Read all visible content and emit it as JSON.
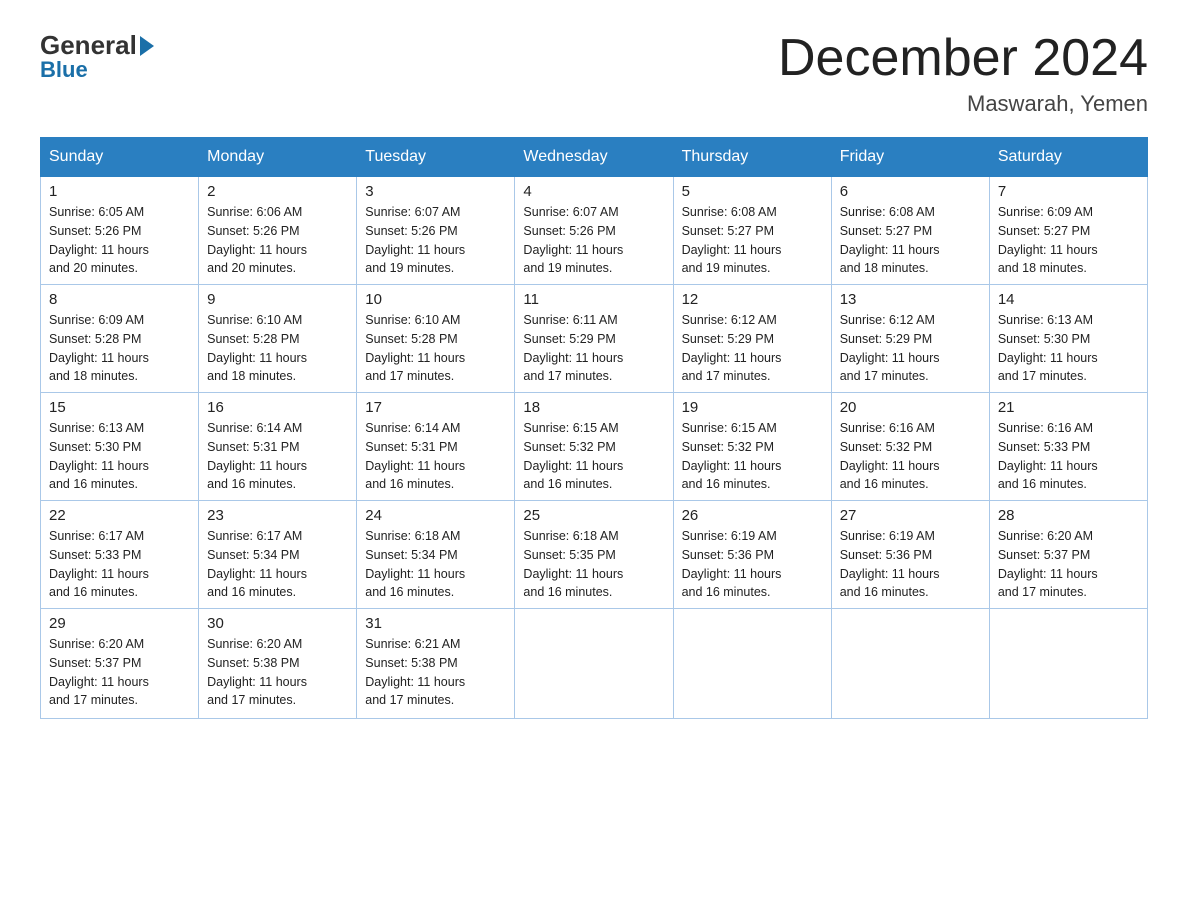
{
  "logo": {
    "general": "General",
    "blue": "Blue"
  },
  "title": {
    "month_year": "December 2024",
    "location": "Maswarah, Yemen"
  },
  "headers": [
    "Sunday",
    "Monday",
    "Tuesday",
    "Wednesday",
    "Thursday",
    "Friday",
    "Saturday"
  ],
  "weeks": [
    [
      {
        "day": "1",
        "info": "Sunrise: 6:05 AM\nSunset: 5:26 PM\nDaylight: 11 hours\nand 20 minutes."
      },
      {
        "day": "2",
        "info": "Sunrise: 6:06 AM\nSunset: 5:26 PM\nDaylight: 11 hours\nand 20 minutes."
      },
      {
        "day": "3",
        "info": "Sunrise: 6:07 AM\nSunset: 5:26 PM\nDaylight: 11 hours\nand 19 minutes."
      },
      {
        "day": "4",
        "info": "Sunrise: 6:07 AM\nSunset: 5:26 PM\nDaylight: 11 hours\nand 19 minutes."
      },
      {
        "day": "5",
        "info": "Sunrise: 6:08 AM\nSunset: 5:27 PM\nDaylight: 11 hours\nand 19 minutes."
      },
      {
        "day": "6",
        "info": "Sunrise: 6:08 AM\nSunset: 5:27 PM\nDaylight: 11 hours\nand 18 minutes."
      },
      {
        "day": "7",
        "info": "Sunrise: 6:09 AM\nSunset: 5:27 PM\nDaylight: 11 hours\nand 18 minutes."
      }
    ],
    [
      {
        "day": "8",
        "info": "Sunrise: 6:09 AM\nSunset: 5:28 PM\nDaylight: 11 hours\nand 18 minutes."
      },
      {
        "day": "9",
        "info": "Sunrise: 6:10 AM\nSunset: 5:28 PM\nDaylight: 11 hours\nand 18 minutes."
      },
      {
        "day": "10",
        "info": "Sunrise: 6:10 AM\nSunset: 5:28 PM\nDaylight: 11 hours\nand 17 minutes."
      },
      {
        "day": "11",
        "info": "Sunrise: 6:11 AM\nSunset: 5:29 PM\nDaylight: 11 hours\nand 17 minutes."
      },
      {
        "day": "12",
        "info": "Sunrise: 6:12 AM\nSunset: 5:29 PM\nDaylight: 11 hours\nand 17 minutes."
      },
      {
        "day": "13",
        "info": "Sunrise: 6:12 AM\nSunset: 5:29 PM\nDaylight: 11 hours\nand 17 minutes."
      },
      {
        "day": "14",
        "info": "Sunrise: 6:13 AM\nSunset: 5:30 PM\nDaylight: 11 hours\nand 17 minutes."
      }
    ],
    [
      {
        "day": "15",
        "info": "Sunrise: 6:13 AM\nSunset: 5:30 PM\nDaylight: 11 hours\nand 16 minutes."
      },
      {
        "day": "16",
        "info": "Sunrise: 6:14 AM\nSunset: 5:31 PM\nDaylight: 11 hours\nand 16 minutes."
      },
      {
        "day": "17",
        "info": "Sunrise: 6:14 AM\nSunset: 5:31 PM\nDaylight: 11 hours\nand 16 minutes."
      },
      {
        "day": "18",
        "info": "Sunrise: 6:15 AM\nSunset: 5:32 PM\nDaylight: 11 hours\nand 16 minutes."
      },
      {
        "day": "19",
        "info": "Sunrise: 6:15 AM\nSunset: 5:32 PM\nDaylight: 11 hours\nand 16 minutes."
      },
      {
        "day": "20",
        "info": "Sunrise: 6:16 AM\nSunset: 5:32 PM\nDaylight: 11 hours\nand 16 minutes."
      },
      {
        "day": "21",
        "info": "Sunrise: 6:16 AM\nSunset: 5:33 PM\nDaylight: 11 hours\nand 16 minutes."
      }
    ],
    [
      {
        "day": "22",
        "info": "Sunrise: 6:17 AM\nSunset: 5:33 PM\nDaylight: 11 hours\nand 16 minutes."
      },
      {
        "day": "23",
        "info": "Sunrise: 6:17 AM\nSunset: 5:34 PM\nDaylight: 11 hours\nand 16 minutes."
      },
      {
        "day": "24",
        "info": "Sunrise: 6:18 AM\nSunset: 5:34 PM\nDaylight: 11 hours\nand 16 minutes."
      },
      {
        "day": "25",
        "info": "Sunrise: 6:18 AM\nSunset: 5:35 PM\nDaylight: 11 hours\nand 16 minutes."
      },
      {
        "day": "26",
        "info": "Sunrise: 6:19 AM\nSunset: 5:36 PM\nDaylight: 11 hours\nand 16 minutes."
      },
      {
        "day": "27",
        "info": "Sunrise: 6:19 AM\nSunset: 5:36 PM\nDaylight: 11 hours\nand 16 minutes."
      },
      {
        "day": "28",
        "info": "Sunrise: 6:20 AM\nSunset: 5:37 PM\nDaylight: 11 hours\nand 17 minutes."
      }
    ],
    [
      {
        "day": "29",
        "info": "Sunrise: 6:20 AM\nSunset: 5:37 PM\nDaylight: 11 hours\nand 17 minutes."
      },
      {
        "day": "30",
        "info": "Sunrise: 6:20 AM\nSunset: 5:38 PM\nDaylight: 11 hours\nand 17 minutes."
      },
      {
        "day": "31",
        "info": "Sunrise: 6:21 AM\nSunset: 5:38 PM\nDaylight: 11 hours\nand 17 minutes."
      },
      {
        "day": "",
        "info": ""
      },
      {
        "day": "",
        "info": ""
      },
      {
        "day": "",
        "info": ""
      },
      {
        "day": "",
        "info": ""
      }
    ]
  ]
}
